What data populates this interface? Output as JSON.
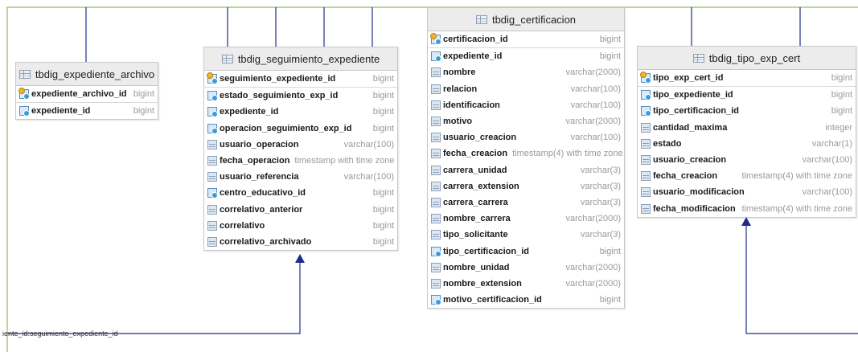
{
  "diagram": {
    "relationship_label": "iente_id:seguimiento_expediente_id",
    "tables": [
      {
        "id": "t1",
        "name": "tbdig_expediente_archivo",
        "columns": [
          {
            "name": "expediente_archivo_id",
            "type": "bigint",
            "icon": "pk-icon"
          },
          {
            "name": "expediente_id",
            "type": "bigint",
            "icon": "fk-icon"
          }
        ]
      },
      {
        "id": "t2",
        "name": "tbdig_seguimiento_expediente",
        "columns": [
          {
            "name": "seguimiento_expediente_id",
            "type": "bigint",
            "icon": "pk-icon"
          },
          {
            "name": "estado_seguimiento_exp_id",
            "type": "bigint",
            "icon": "fk-icon"
          },
          {
            "name": "expediente_id",
            "type": "bigint",
            "icon": "fk-icon"
          },
          {
            "name": "operacion_seguimiento_exp_id",
            "type": "bigint",
            "icon": "fk-icon"
          },
          {
            "name": "usuario_operacion",
            "type": "varchar(100)",
            "icon": "column-icon"
          },
          {
            "name": "fecha_operacion",
            "type": "timestamp with time zone",
            "icon": "column-icon"
          },
          {
            "name": "usuario_referencia",
            "type": "varchar(100)",
            "icon": "column-icon"
          },
          {
            "name": "centro_educativo_id",
            "type": "bigint",
            "icon": "fk-icon"
          },
          {
            "name": "correlativo_anterior",
            "type": "bigint",
            "icon": "column-icon"
          },
          {
            "name": "correlativo",
            "type": "bigint",
            "icon": "column-icon"
          },
          {
            "name": "correlativo_archivado",
            "type": "bigint",
            "icon": "column-icon"
          }
        ]
      },
      {
        "id": "t3",
        "name": "tbdig_certificacion",
        "columns": [
          {
            "name": "certificacion_id",
            "type": "bigint",
            "icon": "pk-icon"
          },
          {
            "name": "expediente_id",
            "type": "bigint",
            "icon": "fk-icon"
          },
          {
            "name": "nombre",
            "type": "varchar(2000)",
            "icon": "column-icon"
          },
          {
            "name": "relacion",
            "type": "varchar(100)",
            "icon": "column-icon"
          },
          {
            "name": "identificacion",
            "type": "varchar(100)",
            "icon": "column-icon"
          },
          {
            "name": "motivo",
            "type": "varchar(2000)",
            "icon": "column-icon"
          },
          {
            "name": "usuario_creacion",
            "type": "varchar(100)",
            "icon": "column-icon"
          },
          {
            "name": "fecha_creacion",
            "type": "timestamp(4) with time zone",
            "icon": "column-icon"
          },
          {
            "name": "carrera_unidad",
            "type": "varchar(3)",
            "icon": "column-icon"
          },
          {
            "name": "carrera_extension",
            "type": "varchar(3)",
            "icon": "column-icon"
          },
          {
            "name": "carrera_carrera",
            "type": "varchar(3)",
            "icon": "column-icon"
          },
          {
            "name": "nombre_carrera",
            "type": "varchar(2000)",
            "icon": "column-icon"
          },
          {
            "name": "tipo_solicitante",
            "type": "varchar(3)",
            "icon": "column-icon"
          },
          {
            "name": "tipo_certificacion_id",
            "type": "bigint",
            "icon": "fk-icon"
          },
          {
            "name": "nombre_unidad",
            "type": "varchar(2000)",
            "icon": "column-icon"
          },
          {
            "name": "nombre_extension",
            "type": "varchar(2000)",
            "icon": "column-icon"
          },
          {
            "name": "motivo_certificacion_id",
            "type": "bigint",
            "icon": "fk-icon"
          }
        ]
      },
      {
        "id": "t4",
        "name": "tbdig_tipo_exp_cert",
        "columns": [
          {
            "name": "tipo_exp_cert_id",
            "type": "bigint",
            "icon": "pk-icon"
          },
          {
            "name": "tipo_expediente_id",
            "type": "bigint",
            "icon": "fk-icon"
          },
          {
            "name": "tipo_certificacion_id",
            "type": "bigint",
            "icon": "fk-icon"
          },
          {
            "name": "cantidad_maxima",
            "type": "integer",
            "icon": "column-icon"
          },
          {
            "name": "estado",
            "type": "varchar(1)",
            "icon": "column-icon"
          },
          {
            "name": "usuario_creacion",
            "type": "varchar(100)",
            "icon": "column-icon"
          },
          {
            "name": "fecha_creacion",
            "type": "timestamp(4) with time zone",
            "icon": "column-icon"
          },
          {
            "name": "usuario_modificacion",
            "type": "varchar(100)",
            "icon": "column-icon"
          },
          {
            "name": "fecha_modificacion",
            "type": "timestamp(4) with time zone",
            "icon": "column-icon"
          }
        ]
      }
    ],
    "colors": {
      "relation_line": "#1f2a8c",
      "canvas_border": "#8fbf5a",
      "header_bg": "#ececec",
      "type_text": "#9a9a9a"
    }
  }
}
